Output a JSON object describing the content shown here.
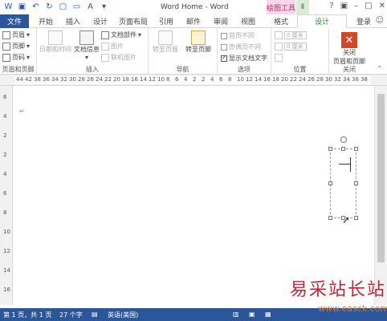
{
  "title_bar": {
    "doc_title": "Word Home - Word",
    "context_tab_group": "绘图工具",
    "context_tab_group2": "Ⅱ"
  },
  "tabs": [
    {
      "label": "文件"
    },
    {
      "label": "开始"
    },
    {
      "label": "插入"
    },
    {
      "label": "设计"
    },
    {
      "label": "页面布局"
    },
    {
      "label": "引用"
    },
    {
      "label": "邮件"
    },
    {
      "label": "审阅"
    },
    {
      "label": "视图"
    },
    {
      "label": "格式"
    },
    {
      "label": "设计"
    }
  ],
  "login": "登录",
  "ribbon": {
    "hf_group": {
      "header": "页眉",
      "footer": "页脚",
      "page_number": "页码",
      "label": "页眉和页脚"
    },
    "insert_group": {
      "date_time": "日期和时间",
      "doc_info": "文档信息",
      "doc_parts": "文档部件",
      "picture": "图片",
      "online_picture": "联机图片",
      "label": "插入"
    },
    "nav_group": {
      "goto_header": "转至页眉",
      "goto_footer": "转至页脚",
      "label": "导航"
    },
    "options_group": {
      "diff_first": "首页不同",
      "diff_odd_even": "奇偶页不同",
      "show_doc_text": "显示文档文字",
      "label": "选项"
    },
    "position_group": {
      "top_value": "0 厘米",
      "bottom_value": "0 厘米",
      "label": "位置"
    },
    "close_group": {
      "close_line1": "关闭",
      "close_line2": "页眉和页脚",
      "label": "关闭"
    }
  },
  "ruler_numbers": [
    "44",
    "42",
    "38",
    "36",
    "34",
    "32",
    "30",
    "28",
    "26",
    "24",
    "22",
    "20",
    "18",
    "16",
    "14",
    "12",
    "10",
    "8",
    "6",
    "4",
    "2",
    "2",
    "4",
    "6",
    "8",
    "10",
    "12",
    "14",
    "16",
    "18",
    "20",
    "22",
    "24",
    "26",
    "28",
    "30",
    "32",
    "34",
    "36",
    "38"
  ],
  "vruler_numbers": [
    "6",
    "4",
    "2",
    "2",
    "4",
    "6",
    "8",
    "10",
    "12",
    "14",
    "16"
  ],
  "status": {
    "page": "第 1 页，共 1 页",
    "words": "27 个字",
    "language": "英语(美国)"
  },
  "watermark": {
    "text_cn": "易采站长站",
    "url": "www.easck.com"
  }
}
